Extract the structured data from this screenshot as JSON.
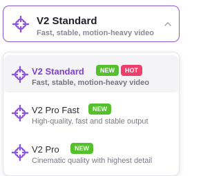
{
  "selected": {
    "title": "V2 Standard",
    "subtitle": "Fast, stable, motion-heavy video",
    "icon": "plus-swirl-icon"
  },
  "options": [
    {
      "title": "V2 Standard",
      "subtitle": "Fast, stable, motion-heavy video",
      "badges": [
        "NEW",
        "HOT"
      ],
      "active": true
    },
    {
      "title": "V2 Pro Fast",
      "subtitle": "High-quality, fast and stable output",
      "badges": [
        "NEW"
      ],
      "active": false
    },
    {
      "title": "V2 Pro",
      "subtitle": "Cinematic quality with highest detail",
      "badges": [
        "NEW"
      ],
      "active": false
    }
  ],
  "colors": {
    "accent": "#7f3fd8",
    "border": "#8a55d8",
    "new_badge": "#53c02c",
    "hot_badge": "#ef3e6c"
  }
}
